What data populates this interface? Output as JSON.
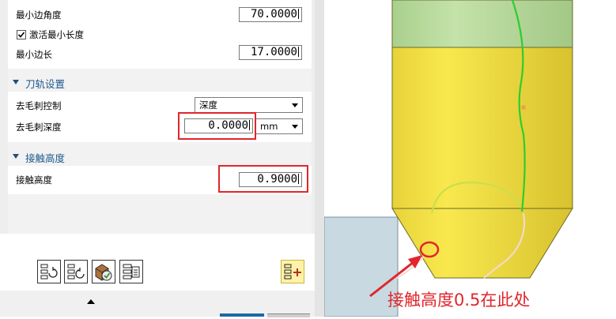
{
  "params": {
    "min_edge_angle_label": "最小边角度",
    "min_edge_angle_value": "70.0000",
    "activate_min_length_label": "激活最小长度",
    "activate_min_length_checked": true,
    "min_edge_length_label": "最小边长",
    "min_edge_length_value": "17.0000"
  },
  "toolpath_section": {
    "title": "刀轨设置",
    "deburr_control_label": "去毛刺控制",
    "deburr_control_value": "深度",
    "deburr_depth_label": "去毛刺深度",
    "deburr_depth_value": "0.0000",
    "deburr_depth_unit": "mm"
  },
  "contact_section": {
    "title": "接触高度",
    "contact_height_label": "接触高度",
    "contact_height_value": "0.9000"
  },
  "annotation": {
    "text": "接触高度0.5在此处"
  },
  "colors": {
    "highlight_red": "#e0262b",
    "section_title_blue": "#1f5a8e",
    "tool_yellow": "#f4e046",
    "tool_shank_green": "#b6d99c",
    "toolpath_green": "#2ecc2e",
    "stock_blue": "#c8d9e1"
  },
  "icons": [
    "operation-regenerate-icon",
    "operation-regenerate-alt-icon",
    "verify-toolpath-icon",
    "list-toolpath-icon",
    "generate-toolpath-icon",
    "collapse-arrow-icon"
  ]
}
